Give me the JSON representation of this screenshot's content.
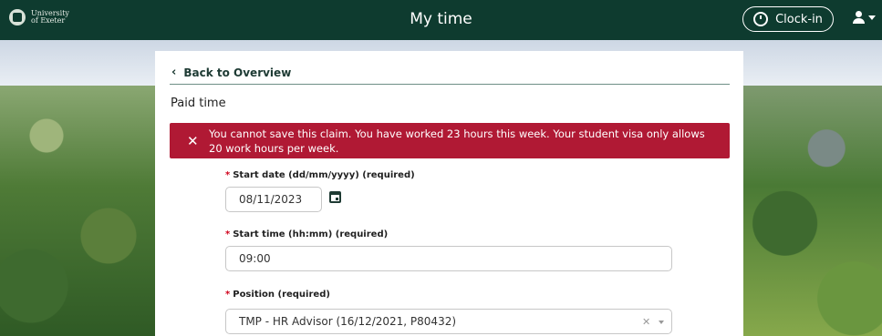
{
  "header": {
    "logo_text": "University of Exeter",
    "app_title": "My time",
    "clock_in_label": "Clock-in"
  },
  "nav": {
    "back_label": "Back to Overview"
  },
  "section": {
    "title": "Paid time"
  },
  "alert": {
    "message": "You cannot save this claim. You have worked 23 hours this week. Your student visa only allows 20 work hours per week."
  },
  "form": {
    "start_date": {
      "label": "Start date (dd/mm/yyyy) (required)",
      "value": "08/11/2023"
    },
    "start_time": {
      "label": "Start time (hh:mm) (required)",
      "value": "09:00"
    },
    "position": {
      "label": "Position  (required)",
      "value": "TMP - HR Advisor (16/12/2021, P80432)"
    },
    "required_mark": "*"
  },
  "colors": {
    "header_bg": "#0e3b2f",
    "alert_bg": "#b01934",
    "required": "#d0021b"
  },
  "icons": [
    "clock-icon",
    "user-icon",
    "chevron-left-icon",
    "close-icon",
    "calendar-icon",
    "clear-icon",
    "chevron-down-icon"
  ]
}
